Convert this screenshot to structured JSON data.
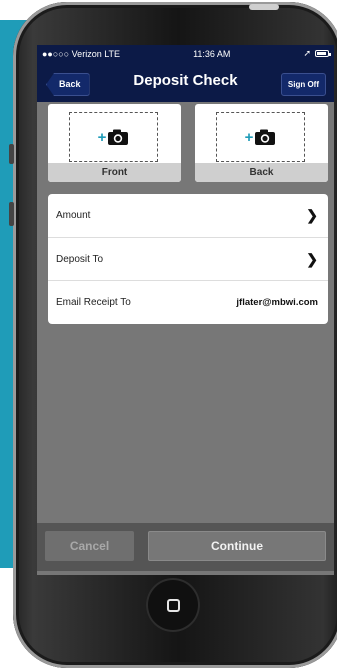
{
  "status_bar": {
    "carrier": "●●○○○ Verizon  LTE",
    "time": "11:36 AM",
    "location": "➚"
  },
  "nav": {
    "back_label": "Back",
    "title": "Deposit Check",
    "signoff_label": "Sign Off"
  },
  "capture": {
    "front_label": "Front",
    "back_label": "Back",
    "plus": "+"
  },
  "fields": [
    {
      "label": "Amount",
      "value": "",
      "chevron": "❯"
    },
    {
      "label": "Deposit To",
      "value": "",
      "chevron": "❯"
    },
    {
      "label": "Email Receipt To",
      "value": "jflater@mbwi.com"
    }
  ],
  "actions": {
    "cancel_label": "Cancel",
    "continue_label": "Continue"
  },
  "colors": {
    "nav_bg": "#0c1a47",
    "accent": "#1f9cb8",
    "content_bg": "#777777"
  },
  "icons": [
    "camera-icon",
    "chevron-right-icon",
    "battery-icon",
    "location-icon",
    "home-button-icon"
  ]
}
